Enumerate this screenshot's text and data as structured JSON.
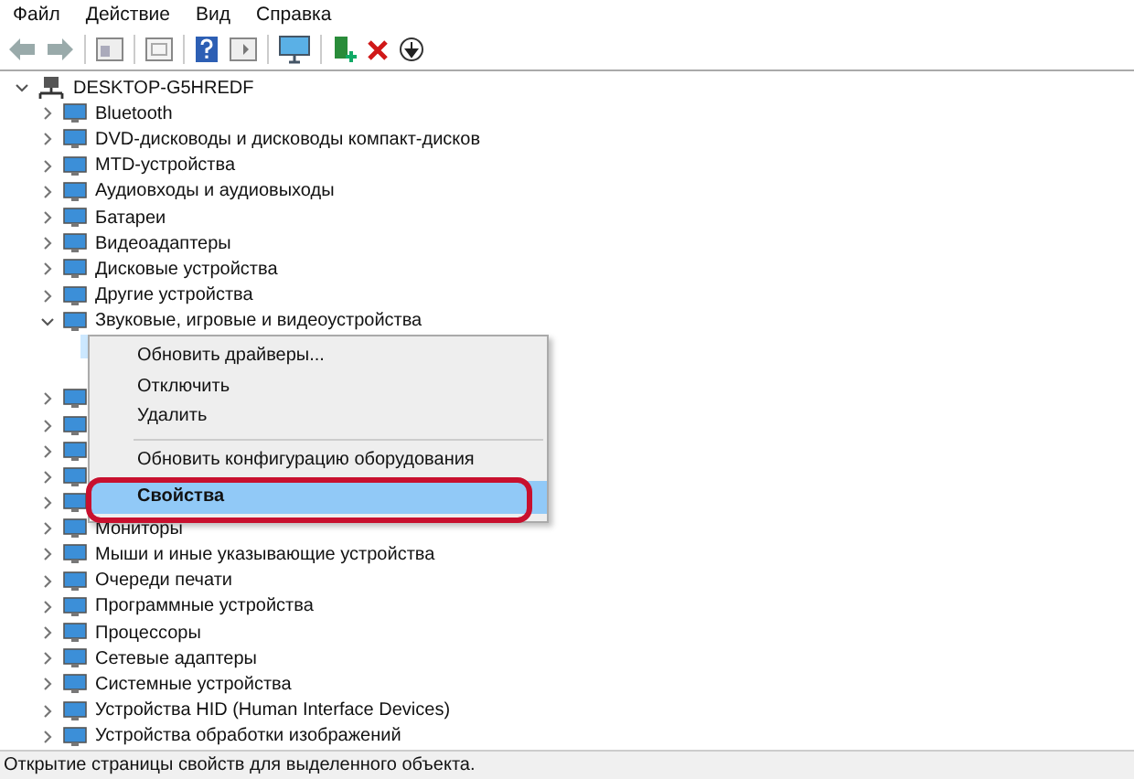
{
  "menu_bar": [
    "Файл",
    "Действие",
    "Вид",
    "Справка"
  ],
  "tree": {
    "label": "DESKTOP-G5HREDF",
    "expanded": true,
    "children": [
      {
        "label": "Bluetooth",
        "expanded": false
      },
      {
        "label": "DVD-дисководы и дисководы компакт-дисков",
        "expanded": false
      },
      {
        "label": "MTD-устройства",
        "expanded": false
      },
      {
        "label": "Аудиовходы и аудиовыходы",
        "expanded": false
      },
      {
        "label": "Батареи",
        "expanded": false
      },
      {
        "label": "Видеоадаптеры",
        "expanded": false
      },
      {
        "label": "Дисковые устройства",
        "expanded": false
      },
      {
        "label": "Другие устройства",
        "expanded": false
      },
      {
        "label": "Звуковые, игровые и видеоустройства",
        "expanded": true,
        "children": [
          {
            "selected": true
          }
        ]
      },
      {
        "expanded": false
      },
      {
        "expanded": false
      },
      {
        "expanded": false
      },
      {
        "expanded": false
      },
      {
        "expanded": false
      },
      {
        "label": "Мониторы",
        "expanded": false
      },
      {
        "label": "Мыши и иные указывающие устройства",
        "expanded": false
      },
      {
        "label": "Очереди печати",
        "expanded": false
      },
      {
        "label": "Программные устройства",
        "expanded": false
      },
      {
        "label": "Процессоры",
        "expanded": false
      },
      {
        "label": "Сетевые адаптеры",
        "expanded": false
      },
      {
        "label": "Системные устройства",
        "expanded": false
      },
      {
        "label": "Устройства HID (Human Interface Devices)",
        "expanded": false
      },
      {
        "label": "Устройства обработки изображений",
        "expanded": false
      }
    ]
  },
  "context_menu": [
    {
      "kind": "item",
      "label": "Обновить драйверы...",
      "selected": false
    },
    {
      "kind": "item",
      "label": "Отключить",
      "selected": false
    },
    {
      "kind": "item",
      "label": "Удалить",
      "selected": false
    },
    {
      "kind": "separator"
    },
    {
      "kind": "item",
      "label": "Обновить конфигурацию оборудования",
      "selected": false
    },
    {
      "kind": "item",
      "label": "Свойства",
      "selected": true
    }
  ],
  "status_bar": "Открытие страницы свойств для выделенного объекта."
}
